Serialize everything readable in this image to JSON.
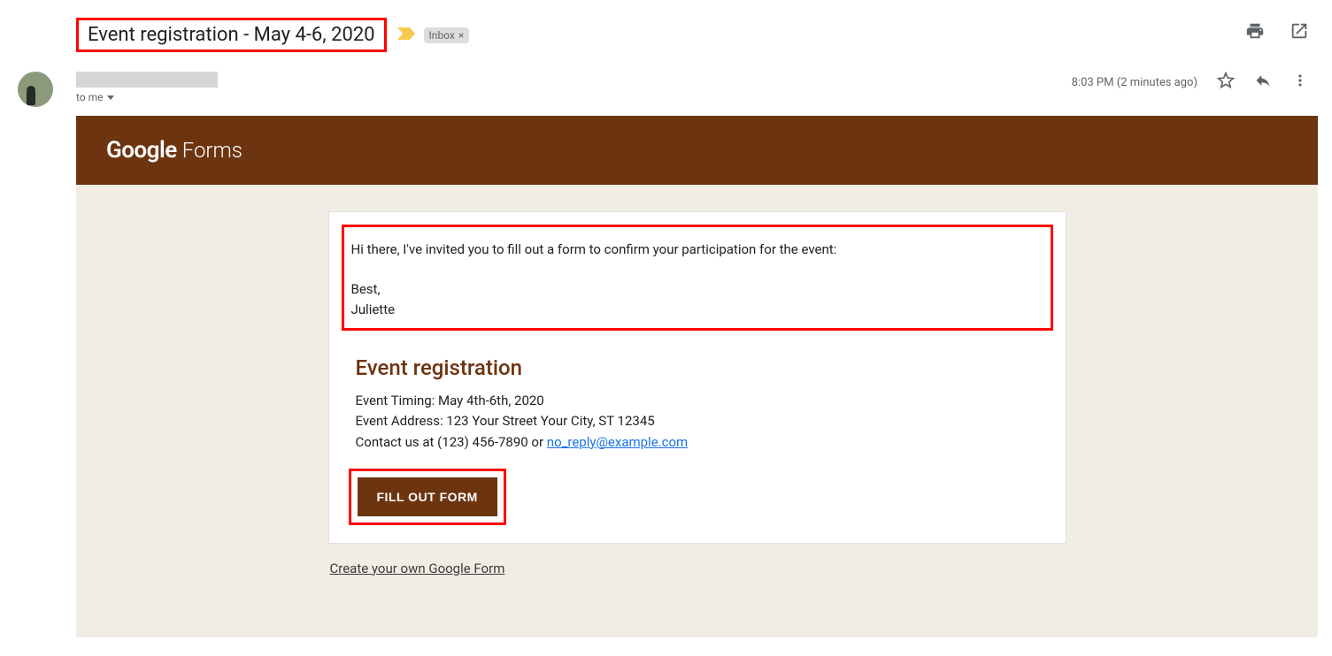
{
  "header": {
    "subject": "Event registration - May 4-6, 2020",
    "label": "Inbox",
    "label_close": "×"
  },
  "sender": {
    "to_line": "to me",
    "timestamp": "8:03 PM (2 minutes ago)"
  },
  "body": {
    "banner_google": "Google",
    "banner_forms": "Forms",
    "message_greeting": "Hi there, I've invited you to fill out a form to confirm your participation for the event:",
    "message_closing": "Best,",
    "message_signature": "Juliette",
    "form_title": "Event registration",
    "detail_timing": "Event Timing: May 4th-6th, 2020",
    "detail_address": "Event Address: 123 Your Street Your City, ST 12345",
    "detail_contact_prefix": "Contact us at (123) 456-7890 or ",
    "detail_contact_email": "no_reply@example.com",
    "button_label": "FILL OUT FORM",
    "create_link": "Create your own Google Form"
  }
}
